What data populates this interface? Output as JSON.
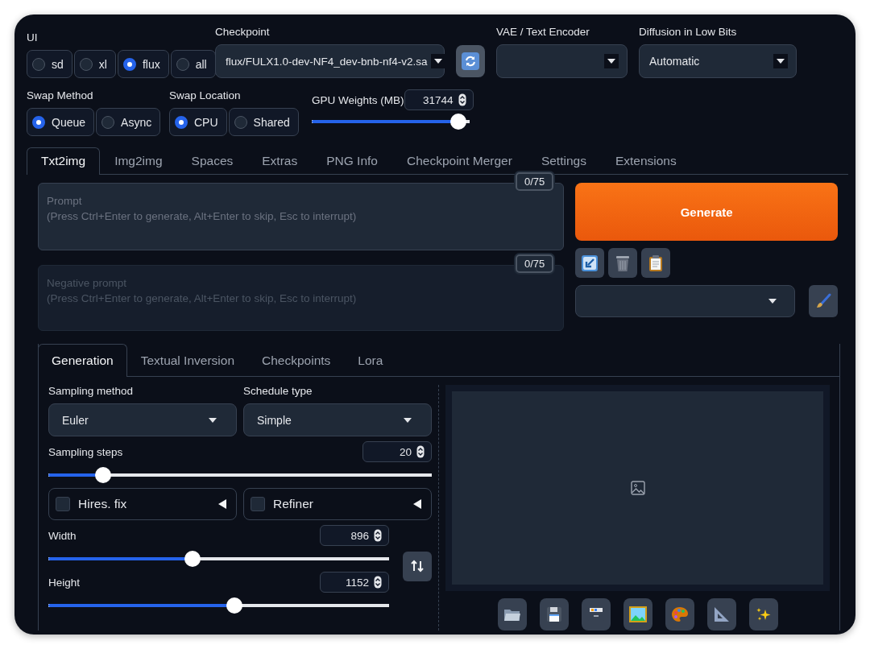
{
  "ui": {
    "label": "UI",
    "options": [
      {
        "label": "sd",
        "selected": false
      },
      {
        "label": "xl",
        "selected": false
      },
      {
        "label": "flux",
        "selected": true
      },
      {
        "label": "all",
        "selected": false
      }
    ]
  },
  "checkpoint": {
    "label": "Checkpoint",
    "value": "flux/FULX1.0-dev-NF4_dev-bnb-nf4-v2.sa"
  },
  "vae": {
    "label": "VAE / Text Encoder"
  },
  "low_bits": {
    "label": "Diffusion in Low Bits",
    "value": "Automatic"
  },
  "swap_method": {
    "label": "Swap Method",
    "options": [
      {
        "label": "Queue",
        "selected": true
      },
      {
        "label": "Async",
        "selected": false
      }
    ]
  },
  "swap_location": {
    "label": "Swap Location",
    "options": [
      {
        "label": "CPU",
        "selected": true
      },
      {
        "label": "Shared",
        "selected": false
      }
    ]
  },
  "gpu_weights": {
    "label": "GPU Weights (MB)",
    "value": "31744",
    "level": 0.93
  },
  "tabs": [
    {
      "label": "Txt2img",
      "selected": true
    },
    {
      "label": "Img2img",
      "selected": false
    },
    {
      "label": "Spaces",
      "selected": false
    },
    {
      "label": "Extras",
      "selected": false
    },
    {
      "label": "PNG Info",
      "selected": false
    },
    {
      "label": "Checkpoint Merger",
      "selected": false
    },
    {
      "label": "Settings",
      "selected": false
    },
    {
      "label": "Extensions",
      "selected": false
    }
  ],
  "prompt": {
    "placeholder": "Prompt\n(Press Ctrl+Enter to generate, Alt+Enter to skip, Esc to interrupt)",
    "counter": "0/75"
  },
  "negative_prompt": {
    "placeholder": "Negative prompt\n(Press Ctrl+Enter to generate, Alt+Enter to skip, Esc to interrupt)",
    "counter": "0/75"
  },
  "generate": {
    "label": "Generate"
  },
  "sub_tabs": [
    {
      "label": "Generation",
      "selected": true
    },
    {
      "label": "Textual Inversion",
      "selected": false
    },
    {
      "label": "Checkpoints",
      "selected": false
    },
    {
      "label": "Lora",
      "selected": false
    }
  ],
  "sampling_method": {
    "label": "Sampling method",
    "value": "Euler"
  },
  "schedule_type": {
    "label": "Schedule type",
    "value": "Simple"
  },
  "sampling_steps": {
    "label": "Sampling steps",
    "value": "20",
    "level": 0.143
  },
  "accordions": [
    {
      "label": "Hires. fix",
      "checked": false
    },
    {
      "label": "Refiner",
      "checked": false
    }
  ],
  "width": {
    "label": "Width",
    "value": "896",
    "level": 0.423
  },
  "height": {
    "label": "Height",
    "value": "1152",
    "level": 0.546
  }
}
